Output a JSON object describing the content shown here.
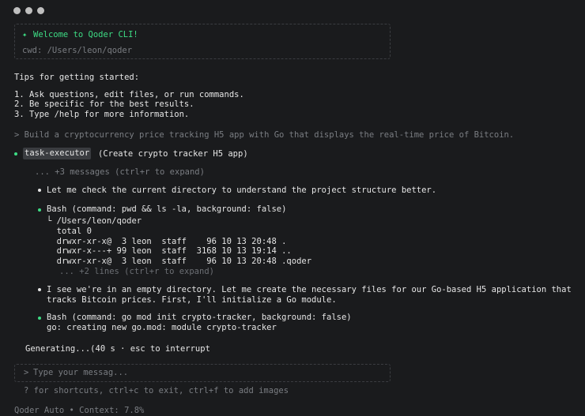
{
  "welcome": {
    "sparkle": "✦",
    "title": "Welcome to Qoder CLI!",
    "cwd": "cwd: /Users/leon/qoder"
  },
  "tips": {
    "heading": "Tips for getting started:",
    "items": [
      "1. Ask questions, edit files, or run commands.",
      "2. Be specific for the best results.",
      "3. Type /help for more information."
    ]
  },
  "prompt": {
    "text": "> Build a cryptocurrency price tracking H5 app with Go that displays the real-time price of Bitcoin."
  },
  "task": {
    "name": "task-executor",
    "desc": "(Create crypto tracker H5 app)",
    "collapsed": "... +3 messages (ctrl+r to expand)",
    "msg1": "Let me check the current directory to understand the project structure better.",
    "bash1": {
      "command": "Bash (command: pwd && ls -la, background: false)",
      "output": [
        "└ /Users/leon/qoder",
        "  total 0",
        "  drwxr-xr-x@  3 leon  staff    96 10 13 20:48 .",
        "  drwxr-x---+ 99 leon  staff  3168 10 13 19:14 ..",
        "  drwxr-xr-x@  3 leon  staff    96 10 13 20:48 .qoder"
      ],
      "more": "... +2 lines (ctrl+r to expand)"
    },
    "msg2_line1": "I see we're in an empty directory. Let me create the necessary files for our Go-based H5 application that",
    "msg2_line2": "tracks Bitcoin prices. First, I'll initialize a Go module.",
    "bash2": {
      "command": "Bash (command: go mod init crypto-tracker, background: false)",
      "output": "go: creating new go.mod: module crypto-tracker"
    }
  },
  "status": "Generating...(40 s · esc to interrupt",
  "input": {
    "prompt": ">",
    "placeholder": "Type your messag..."
  },
  "hint": "? for shortcuts, ctrl+c to exit, ctrl+f to add images",
  "footer": "Qoder Auto • Context: 7.8%",
  "colors": {
    "background": "#1a1b1d",
    "accent": "#3ddc84",
    "text": "#e6e6e6",
    "dim": "#7a7d82"
  }
}
